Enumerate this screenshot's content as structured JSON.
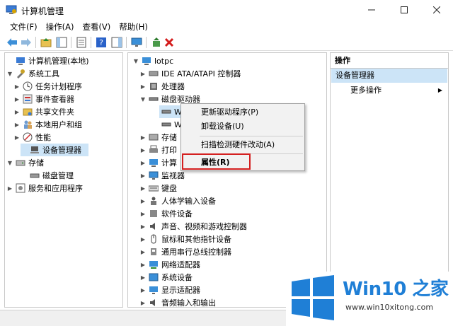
{
  "window": {
    "title": "计算机管理"
  },
  "menubar": [
    {
      "label": "文件(F)"
    },
    {
      "label": "操作(A)"
    },
    {
      "label": "查看(V)"
    },
    {
      "label": "帮助(H)"
    }
  ],
  "left_tree": [
    {
      "label": "计算机管理(本地)",
      "arrow": "",
      "icon": "computer-management-icon"
    },
    {
      "label": "系统工具",
      "arrow": "▼",
      "icon": "tools-icon"
    },
    {
      "label": "任务计划程序",
      "arrow": "▶",
      "icon": "clock-icon"
    },
    {
      "label": "事件查看器",
      "arrow": "▶",
      "icon": "event-viewer-icon"
    },
    {
      "label": "共享文件夹",
      "arrow": "▶",
      "icon": "shared-folder-icon"
    },
    {
      "label": "本地用户和组",
      "arrow": "▶",
      "icon": "users-icon"
    },
    {
      "label": "性能",
      "arrow": "▶",
      "icon": "performance-icon"
    },
    {
      "label": "设备管理器",
      "arrow": "",
      "icon": "device-manager-icon"
    },
    {
      "label": "存储",
      "arrow": "▼",
      "icon": "storage-icon"
    },
    {
      "label": "磁盘管理",
      "arrow": "",
      "icon": "disk-management-icon"
    },
    {
      "label": "服务和应用程序",
      "arrow": "▶",
      "icon": "services-icon"
    }
  ],
  "device_tree": [
    {
      "label": "lotpc",
      "arrow": "▼",
      "icon": "computer-icon"
    },
    {
      "label": "IDE ATA/ATAPI 控制器",
      "arrow": "▶",
      "icon": "ide-controller-icon"
    },
    {
      "label": "处理器",
      "arrow": "▶",
      "icon": "processor-icon"
    },
    {
      "label": "磁盘驱动器",
      "arrow": "▼",
      "icon": "disk-drive-icon"
    },
    {
      "label": "W",
      "arrow": "",
      "icon": "disk-icon"
    },
    {
      "label": "W",
      "arrow": "",
      "icon": "disk-icon"
    },
    {
      "label": "存储",
      "arrow": "▶",
      "icon": "storage-controller-icon"
    },
    {
      "label": "打印",
      "arrow": "▶",
      "icon": "printer-icon"
    },
    {
      "label": "计算",
      "arrow": "▶",
      "icon": "computer-icon"
    },
    {
      "label": "监视器",
      "arrow": "▶",
      "icon": "monitor-icon"
    },
    {
      "label": "键盘",
      "arrow": "▶",
      "icon": "keyboard-icon"
    },
    {
      "label": "人体学输入设备",
      "arrow": "▶",
      "icon": "hid-icon"
    },
    {
      "label": "软件设备",
      "arrow": "▶",
      "icon": "software-device-icon"
    },
    {
      "label": "声音、视频和游戏控制器",
      "arrow": "▶",
      "icon": "sound-icon"
    },
    {
      "label": "鼠标和其他指针设备",
      "arrow": "▶",
      "icon": "mouse-icon"
    },
    {
      "label": "通用串行总线控制器",
      "arrow": "▶",
      "icon": "usb-icon"
    },
    {
      "label": "网络适配器",
      "arrow": "▶",
      "icon": "network-adapter-icon"
    },
    {
      "label": "系统设备",
      "arrow": "▶",
      "icon": "system-device-icon"
    },
    {
      "label": "显示适配器",
      "arrow": "▶",
      "icon": "display-adapter-icon"
    },
    {
      "label": "音频输入和输出",
      "arrow": "▶",
      "icon": "audio-icon"
    }
  ],
  "context_menu": [
    {
      "label": "更新驱动程序(P)"
    },
    {
      "label": "卸载设备(U)"
    },
    {
      "label": "扫描检测硬件改动(A)"
    },
    {
      "label": "属性(R)"
    }
  ],
  "actions": {
    "header": "操作",
    "section": "设备管理器",
    "more": "更多操作"
  },
  "watermark": {
    "title": "Win10 之家",
    "url": "www.win10xitong.com"
  },
  "colors": {
    "selection": "#cce4f7",
    "highlight_box": "#d42020",
    "brand_blue": "#1f7fd6"
  }
}
